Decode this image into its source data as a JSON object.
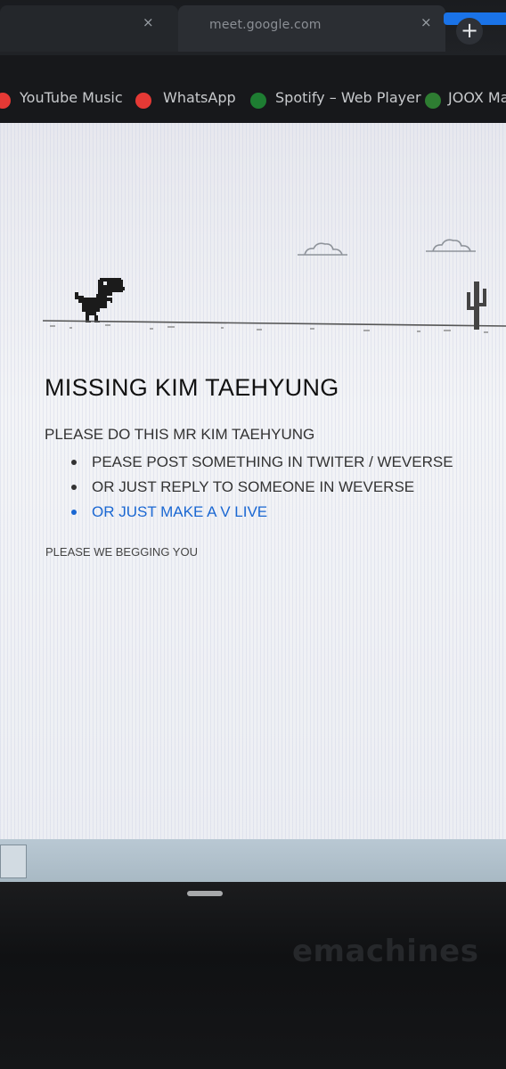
{
  "browser": {
    "tab": {
      "title": "meet.google.com",
      "close_symbol": "×"
    },
    "new_tab_symbol": "+",
    "bookmarks": [
      {
        "label": "YouTube Music",
        "icon": "youtube-music-icon",
        "color": "#e53935"
      },
      {
        "label": "WhatsApp",
        "icon": "whatsapp-icon",
        "color": "#e53935"
      },
      {
        "label": "Spotify – Web Player",
        "icon": "spotify-icon",
        "color": "#1e7d32"
      },
      {
        "label": "JOOX Ma",
        "icon": "joox-icon",
        "color": "#2e7d32"
      }
    ]
  },
  "page": {
    "dino_game": {
      "dino_icon": "t-rex-icon",
      "obstacle_icon": "cactus-icon",
      "cloud_icon": "cloud-icon"
    },
    "headline": "MISSING KIM TAEHYUNG",
    "subhead": "PLEASE DO THIS MR KIM TAEHYUNG",
    "suggestions": [
      "PEASE POST SOMETHING IN TWITER / WEVERSE",
      "OR JUST REPLY TO SOMEONE IN WEVERSE",
      "OR JUST MAKE A V LIVE"
    ],
    "footnote": "PLEASE WE BEGGING YOU"
  },
  "monitor": {
    "brand": "emachines"
  },
  "colors": {
    "link": "#1a67d2",
    "chrome_dark": "#17181b",
    "page_bg": "#eef0f4"
  }
}
